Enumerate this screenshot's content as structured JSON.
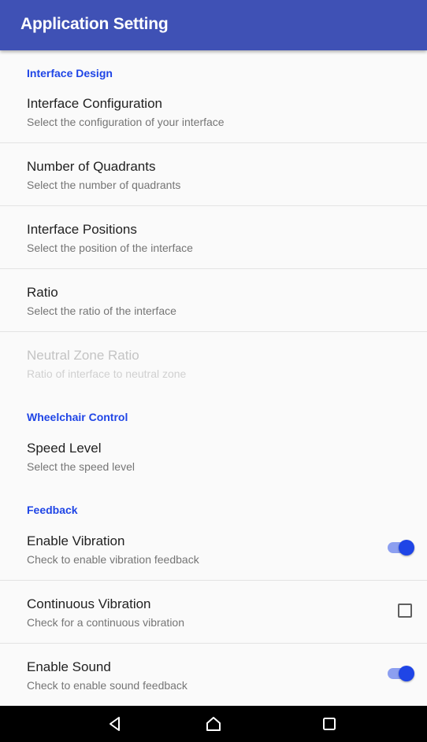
{
  "appbar": {
    "title": "Application Setting"
  },
  "sections": {
    "interface_design": "Interface Design",
    "wheelchair_control": "Wheelchair Control",
    "feedback": "Feedback"
  },
  "prefs": {
    "interface_configuration": {
      "title": "Interface Configuration",
      "summary": "Select the configuration of your interface"
    },
    "number_of_quadrants": {
      "title": "Number of Quadrants",
      "summary": "Select the number of quadrants"
    },
    "interface_positions": {
      "title": "Interface Positions",
      "summary": "Select the position of the interface"
    },
    "ratio": {
      "title": "Ratio",
      "summary": "Select the ratio of the interface"
    },
    "neutral_zone_ratio": {
      "title": "Neutral Zone Ratio",
      "summary": "Ratio of interface to neutral zone",
      "enabled": false
    },
    "speed_level": {
      "title": "Speed Level",
      "summary": "Select the speed level"
    },
    "enable_vibration": {
      "title": "Enable Vibration",
      "summary": "Check to enable vibration feedback",
      "checked": true
    },
    "continuous_vibration": {
      "title": "Continuous Vibration",
      "summary": "Check for a continuous vibration",
      "checked": false
    },
    "enable_sound": {
      "title": "Enable Sound",
      "summary": "Check to enable sound feedback",
      "checked": true
    }
  },
  "colors": {
    "appbar": "#3f51b5",
    "accent": "#1f45e6",
    "switch_track": "#8c9ff0"
  },
  "navbar": {
    "icons": [
      "back-icon",
      "home-icon",
      "recents-icon"
    ]
  }
}
